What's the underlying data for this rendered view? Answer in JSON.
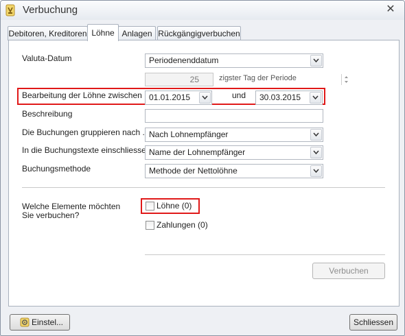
{
  "window": {
    "title": "Verbuchung",
    "close_glyph": "✕",
    "app_icon": "app-logo-icon"
  },
  "tabs": [
    {
      "label": "Debitoren, Kreditoren",
      "active": false
    },
    {
      "label": "Löhne",
      "active": true
    },
    {
      "label": "Anlagen",
      "active": false
    },
    {
      "label": "Rückgängigverbuchen",
      "active": false
    }
  ],
  "form": {
    "valuta": {
      "label": "Valuta-Datum",
      "value": "Periodenenddatum"
    },
    "day_of_period": {
      "value": "25",
      "suffix": "zigster Tag der Periode"
    },
    "period": {
      "label": "Bearbeitung der Löhne zwischen",
      "from": "01.01.2015",
      "and_label": "und",
      "to": "30.03.2015"
    },
    "description": {
      "label": "Beschreibung",
      "value": ""
    },
    "grouping": {
      "label": "Die Buchungen gruppieren nach ...",
      "value": "Nach Lohnempfänger"
    },
    "texts": {
      "label": "In die Buchungstexte einschliessen",
      "value": "Name der Lohnempfänger"
    },
    "method": {
      "label": "Buchungsmethode",
      "value": "Methode der Nettolöhne"
    }
  },
  "elements": {
    "question_line1": "Welche Elemente möchten",
    "question_line2": "Sie verbuchen?",
    "salaries": {
      "label": "Löhne (0)",
      "checked": false
    },
    "payments": {
      "label": "Zahlungen (0)",
      "checked": false
    }
  },
  "buttons": {
    "post": "Verbuchen",
    "settings": "Einstel...",
    "close": "Schliessen"
  },
  "colors": {
    "highlight": "#e01818"
  }
}
